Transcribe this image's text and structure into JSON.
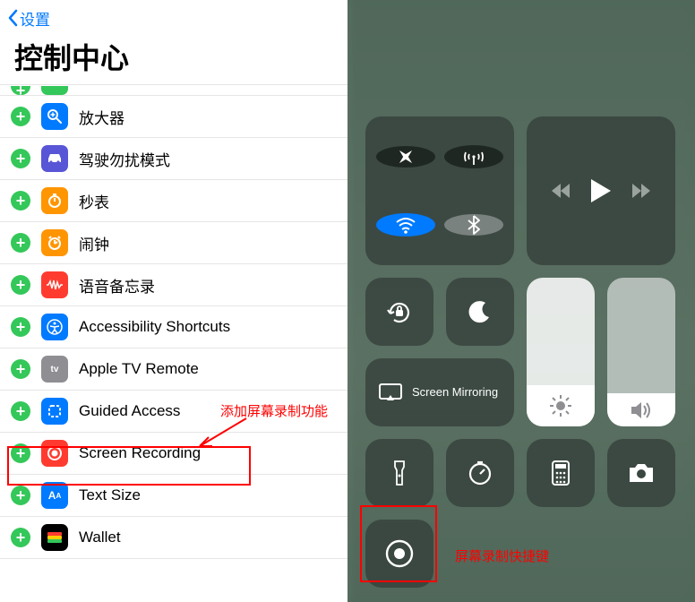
{
  "nav": {
    "back_label": "设置"
  },
  "title": "控制中心",
  "items": [
    {
      "label": "放大器",
      "color": "c-blue",
      "icon": "magnifier"
    },
    {
      "label": "驾驶勿扰模式",
      "color": "c-purple",
      "icon": "car"
    },
    {
      "label": "秒表",
      "color": "c-orange",
      "icon": "stopwatch"
    },
    {
      "label": "闹钟",
      "color": "c-orange",
      "icon": "alarm"
    },
    {
      "label": "语音备忘录",
      "color": "c-red",
      "icon": "voicememo"
    },
    {
      "label": "Accessibility Shortcuts",
      "color": "c-blue",
      "icon": "accessibility"
    },
    {
      "label": "Apple TV Remote",
      "color": "c-grey",
      "icon": "appletv"
    },
    {
      "label": "Guided Access",
      "color": "c-dashed",
      "icon": "guided"
    },
    {
      "label": "Screen Recording",
      "color": "c-red",
      "icon": "record"
    },
    {
      "label": "Text Size",
      "color": "c-text",
      "icon": "textsize"
    },
    {
      "label": "Wallet",
      "color": "c-wallet",
      "icon": "wallet"
    }
  ],
  "cut_item_label": "",
  "annotations": {
    "add_note": "添加屏幕录制功能",
    "shortcut_note": "屏幕录制快捷键"
  },
  "cc": {
    "mirror_label": "Screen Mirroring"
  }
}
